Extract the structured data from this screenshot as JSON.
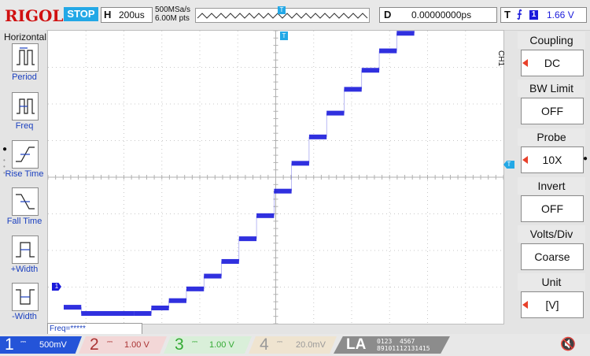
{
  "top": {
    "brand": "RIGOL",
    "run_status": "STOP",
    "horizontal": {
      "key": "H",
      "timebase": "200us"
    },
    "sample_rate": "500MSa/s",
    "memory_depth": "6.00M pts",
    "trigger_pos_marker": "T",
    "delay": {
      "key": "D",
      "value": "0.00000000ps"
    },
    "trigger": {
      "key": "T",
      "edge": "⨍",
      "channel": "1",
      "level": "1.66 V"
    }
  },
  "left_menu": {
    "title": "Horizontal",
    "items": [
      {
        "label": "Period",
        "icon": "period-icon"
      },
      {
        "label": "Freq",
        "icon": "freq-icon"
      },
      {
        "label": "Rise Time",
        "icon": "rise-time-icon"
      },
      {
        "label": "Fall Time",
        "icon": "fall-time-icon"
      },
      {
        "label": "+Width",
        "icon": "positive-width-icon"
      },
      {
        "label": "-Width",
        "icon": "negative-width-icon"
      }
    ]
  },
  "right_menu": {
    "channel_tag": "CH1",
    "items": [
      {
        "title": "Coupling",
        "value": "DC",
        "has_arrow": true
      },
      {
        "title": "BW Limit",
        "value": "OFF",
        "has_arrow": false
      },
      {
        "title": "Probe",
        "value": "10X",
        "has_arrow": true
      },
      {
        "title": "Invert",
        "value": "OFF",
        "has_arrow": false
      },
      {
        "title": "Volts/Div",
        "value": "Coarse",
        "has_arrow": false
      },
      {
        "title": "Unit",
        "value": "[V]",
        "has_arrow": true
      }
    ]
  },
  "screen": {
    "trigger_marker": "T",
    "channel_marker": "1",
    "right_trigger_marker": "T",
    "waveform_color": "#1a1adb",
    "grid_color": "#c8c8c8",
    "waveform_steps": [
      {
        "t": 0.0,
        "v": -3.55
      },
      {
        "t": 0.04,
        "v": -3.72
      },
      {
        "t": 0.16,
        "v": -3.72
      },
      {
        "t": 0.2,
        "v": -3.57
      },
      {
        "t": 0.24,
        "v": -3.37
      },
      {
        "t": 0.28,
        "v": -3.05
      },
      {
        "t": 0.32,
        "v": -2.7
      },
      {
        "t": 0.36,
        "v": -2.3
      },
      {
        "t": 0.4,
        "v": -1.68
      },
      {
        "t": 0.44,
        "v": -1.05
      },
      {
        "t": 0.48,
        "v": -0.38
      },
      {
        "t": 0.52,
        "v": 0.38
      },
      {
        "t": 0.56,
        "v": 1.1
      },
      {
        "t": 0.6,
        "v": 1.75
      },
      {
        "t": 0.64,
        "v": 2.4
      },
      {
        "t": 0.68,
        "v": 2.92
      },
      {
        "t": 0.72,
        "v": 3.45
      },
      {
        "t": 0.76,
        "v": 3.93
      },
      {
        "t": 0.8,
        "v": 4.4
      },
      {
        "t": 0.84,
        "v": 4.8
      },
      {
        "t": 0.88,
        "v": 5.1
      },
      {
        "t": 0.92,
        "v": 5.45
      },
      {
        "t": 0.96,
        "v": 5.45
      },
      {
        "t": 1.0,
        "v": 5.45
      }
    ]
  },
  "freq_readout": "Freq=*****",
  "bottom": {
    "ch1": {
      "num": "1",
      "coupling": "⎓",
      "scale": "500mV"
    },
    "ch2": {
      "num": "2",
      "coupling": "⎓",
      "scale": "1.00 V"
    },
    "ch3": {
      "num": "3",
      "coupling": "⎓",
      "scale": "1.00 V"
    },
    "ch4": {
      "num": "4",
      "coupling": "⎓",
      "scale": "20.0mV"
    },
    "la": {
      "label": "LA",
      "bits_low_top": "0123",
      "bits_low_bot": "891011",
      "bits_high_top": "4567",
      "bits_high_bot": "12131415"
    },
    "speaker_icon": "🔇"
  }
}
